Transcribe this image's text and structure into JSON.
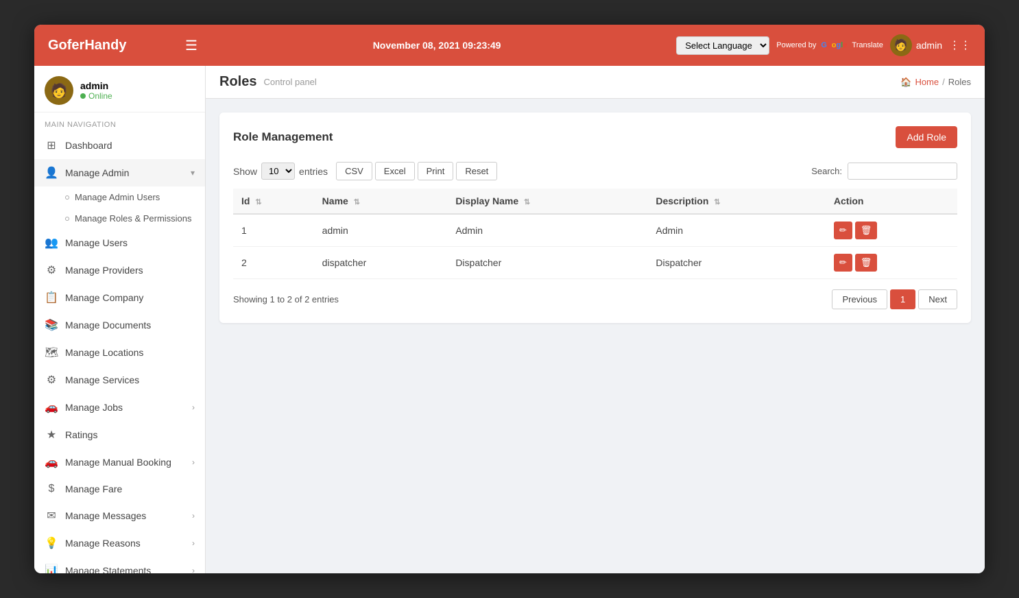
{
  "header": {
    "logo": "GoferHandy",
    "datetime": "November 08, 2021 09:23:49",
    "language_select_label": "Select Language",
    "powered_by": "Powered by",
    "google_label": "Google",
    "translate_label": "Translate",
    "admin_label": "admin"
  },
  "sidebar": {
    "user": {
      "name": "admin",
      "status": "Online"
    },
    "nav_section": "MAIN NAVIGATION",
    "items": [
      {
        "id": "dashboard",
        "label": "Dashboard",
        "icon": "⊞",
        "has_arrow": false
      },
      {
        "id": "manage-admin",
        "label": "Manage Admin",
        "icon": "👤",
        "has_arrow": true
      },
      {
        "id": "manage-admin-users",
        "label": "Manage Admin Users",
        "sub": true
      },
      {
        "id": "manage-roles",
        "label": "Manage Roles & Permissions",
        "sub": true
      },
      {
        "id": "manage-users",
        "label": "Manage Users",
        "icon": "👥",
        "has_arrow": false
      },
      {
        "id": "manage-providers",
        "label": "Manage Providers",
        "icon": "⚙",
        "has_arrow": false
      },
      {
        "id": "manage-company",
        "label": "Manage Company",
        "icon": "📋",
        "has_arrow": false
      },
      {
        "id": "manage-documents",
        "label": "Manage Documents",
        "icon": "📚",
        "has_arrow": false
      },
      {
        "id": "manage-locations",
        "label": "Manage Locations",
        "icon": "🗺",
        "has_arrow": false
      },
      {
        "id": "manage-services",
        "label": "Manage Services",
        "icon": "⚙",
        "has_arrow": false
      },
      {
        "id": "manage-jobs",
        "label": "Manage Jobs",
        "icon": "🚗",
        "has_arrow": true
      },
      {
        "id": "ratings",
        "label": "Ratings",
        "icon": "★",
        "has_arrow": false
      },
      {
        "id": "manage-manual-booking",
        "label": "Manage Manual Booking",
        "icon": "🚗",
        "has_arrow": true
      },
      {
        "id": "manage-fare",
        "label": "Manage Fare",
        "icon": "$",
        "has_arrow": false
      },
      {
        "id": "manage-messages",
        "label": "Manage Messages",
        "icon": "✉",
        "has_arrow": true
      },
      {
        "id": "manage-reasons",
        "label": "Manage Reasons",
        "icon": "💡",
        "has_arrow": true
      },
      {
        "id": "manage-statements",
        "label": "Manage Statements",
        "icon": "📊",
        "has_arrow": true
      }
    ]
  },
  "page": {
    "title": "Roles",
    "subtitle": "Control panel",
    "breadcrumb_home": "Home",
    "breadcrumb_current": "Roles"
  },
  "role_management": {
    "card_title": "Role Management",
    "add_button": "Add Role",
    "show_label": "Show",
    "entries_label": "entries",
    "entries_value": "10",
    "export_buttons": [
      "CSV",
      "Excel",
      "Print",
      "Reset"
    ],
    "search_label": "Search:",
    "columns": [
      {
        "id": "id",
        "label": "Id"
      },
      {
        "id": "name",
        "label": "Name"
      },
      {
        "id": "display_name",
        "label": "Display Name"
      },
      {
        "id": "description",
        "label": "Description"
      },
      {
        "id": "action",
        "label": "Action"
      }
    ],
    "rows": [
      {
        "id": "1",
        "name": "admin",
        "display_name": "Admin",
        "description": "Admin"
      },
      {
        "id": "2",
        "name": "dispatcher",
        "display_name": "Dispatcher",
        "description": "Dispatcher"
      }
    ],
    "showing_info": "Showing 1 to 2 of 2 entries",
    "pagination": {
      "previous": "Previous",
      "next": "Next",
      "current_page": "1"
    }
  }
}
